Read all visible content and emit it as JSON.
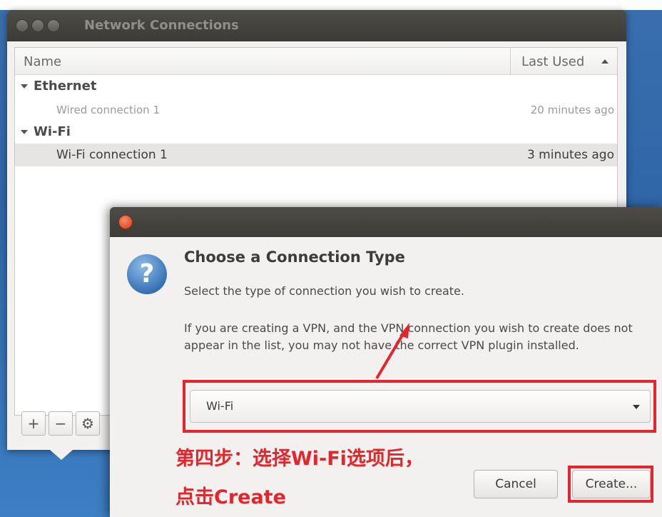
{
  "window": {
    "title": "Network Connections",
    "columns": {
      "name": "Name",
      "last_used": "Last Used"
    },
    "groups": [
      {
        "label": "Ethernet",
        "items": [
          {
            "name": "Wired connection 1",
            "last_used": "20 minutes ago"
          }
        ]
      },
      {
        "label": "Wi-Fi",
        "items": [
          {
            "name": "Wi-Fi connection 1",
            "last_used": "3 minutes ago"
          }
        ]
      }
    ],
    "toolbar": {
      "add": "+",
      "remove": "−",
      "settings": "⚙"
    }
  },
  "dialog": {
    "icon": "question-icon",
    "icon_glyph": "?",
    "heading": "Choose a Connection Type",
    "subtitle": "Select the type of connection you wish to create.",
    "body": "If you are creating a VPN, and the VPN connection you wish to create does not appear in the list, you may not have the correct VPN plugin installed.",
    "select_value": "Wi-Fi",
    "cancel_label": "Cancel",
    "create_label": "Create..."
  },
  "annotation": {
    "line1": "第四步：选择Wi-Fi选项后，",
    "line2": "点击Create",
    "color": "#e3262b"
  },
  "colors": {
    "accent_red": "#e3262b",
    "titlebar": "#3c3b37",
    "desktop": "#2f66a8"
  }
}
